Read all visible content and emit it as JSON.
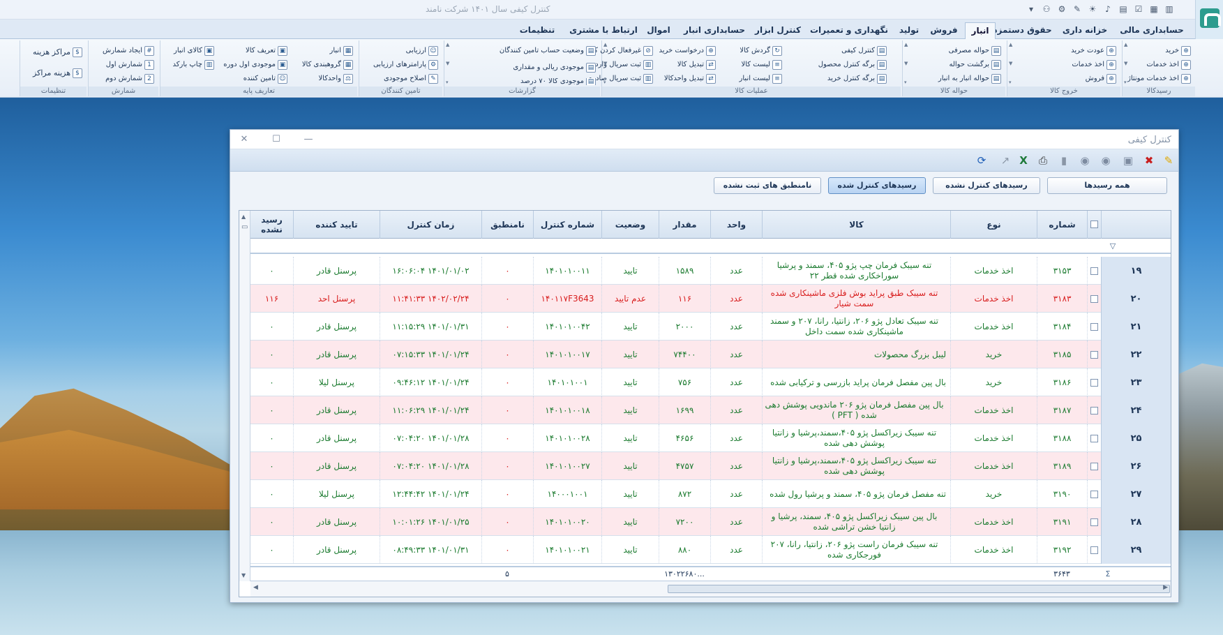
{
  "window_title": "کنترل کیفی    سال ۱۴۰۱ شرکت نامند",
  "ribbon_tabs": [
    "حسابداری مالی",
    "خزانه داری",
    "حقوق دستمزد",
    "انبار",
    "فروش",
    "تولید",
    "نگهداری و تعمیرات",
    "کنترل ابزار",
    "حسابداری انبار",
    "اموال",
    "ارتباط با مشتری",
    "تنظیمات"
  ],
  "active_tab": "انبار",
  "ribbon_groups": {
    "receipt": {
      "label": "رسیدکالا",
      "items": [
        "خرید",
        "اخذ خدمات",
        "اخذ خدمات مونتاژ"
      ]
    },
    "exit": {
      "label": "خروج کالا",
      "items": [
        "عودت خرید",
        "اخذ خدمات",
        "فروش"
      ]
    },
    "transfer": {
      "label": "حواله کالا",
      "items": [
        "حواله مصرفی",
        "برگشت حواله",
        "حواله انبار به انبار"
      ]
    },
    "ops": {
      "label": "عملیات کالا",
      "items": [
        "کنترل کیفی",
        "برگه کنترل محصول",
        "برگه کنترل خرید",
        "گردش کالا",
        "لیست کالا",
        "لیست انبار",
        "درخواست خرید",
        "تبدیل کالا",
        "تبدیل واحدکالا",
        "غیرفعال کردن کالا",
        "ثبت سریال وارده",
        "ثبت سریال صادره"
      ]
    },
    "reports": {
      "label": "گزارشات",
      "items": [
        "وضعیت حساب تامین کنندگان",
        "موجودی ریالی و مقداری",
        "موجودی کالا ۷۰ درصد"
      ]
    },
    "suppliers": {
      "label": "تامین کنندگان",
      "items": [
        "ارزیابی",
        "پارامترهای ارزیابی",
        "اصلاح موجودی"
      ]
    },
    "base": {
      "label": "تعاریف پایه",
      "items": [
        "انبار",
        "گروهبندی کالا",
        "واحدکالا",
        "تعریف کالا",
        "موجودی اول دوره",
        "تامین کننده",
        "کالای انبار",
        "چاپ بارکد"
      ]
    },
    "numbering": {
      "label": "شمارش",
      "items": [
        "ایجاد شمارش",
        "شمارش اول",
        "شمارش دوم"
      ]
    },
    "settings": {
      "label": "تنظیمات",
      "items": [
        "مراکز هزینه",
        "هزینه مراکز"
      ]
    }
  },
  "dialog": {
    "title": "کنترل کیفی",
    "filters": [
      "همه رسیدها",
      "رسیدهای کنترل نشده",
      "رسیدهای کنترل شده",
      "نامنطبق های ثبت نشده"
    ],
    "active_filter": "رسیدهای کنترل شده"
  },
  "grid": {
    "headers": {
      "number": "شماره",
      "type": "نوع",
      "product": "کالا",
      "unit": "واحد",
      "qty": "مقدار",
      "status": "وضعیت",
      "control_no": "شماره کنترل",
      "nonconform": "نامنطبق",
      "control_time": "زمان کنترل",
      "approver": "تایید کننده",
      "unreceived": "رسید نشده"
    },
    "rows": [
      {
        "idx": "۱۹",
        "number": "۳۱۵۳",
        "type": "اخذ خدمات",
        "product": "تنه سیبک فرمان چپ پژو ۴۰۵، سمند و پرشیا سوراخکاری شده قطر ۲۲",
        "unit": "عدد",
        "qty": "۱۵۸۹",
        "status": "تایید",
        "control_no": "۱۴۰۱۰۱۰۰۱۱",
        "nonconform": "۰",
        "control_time": "۱۴۰۱/۰۱/۰۲ ۱۶:۰۶:۰۴",
        "approver": "پرسنل قادر",
        "unreceived": "۰",
        "alt": false,
        "bad": false
      },
      {
        "idx": "۲۰",
        "number": "۳۱۸۳",
        "type": "اخذ خدمات",
        "product": "تنه سیبک طبق پراید بوش فلزی ماشینکاری شده سمت شیار",
        "unit": "عدد",
        "qty": "۱۱۶",
        "status": "عدم تایید",
        "control_no": "۱۴۰۱۱۷F3643",
        "nonconform": "۰",
        "control_time": "۱۴۰۲/۰۲/۲۴ ۱۱:۴۱:۳۳",
        "approver": "پرسنل احد",
        "unreceived": "۱۱۶",
        "alt": true,
        "bad": true
      },
      {
        "idx": "۲۱",
        "number": "۳۱۸۴",
        "type": "اخذ خدمات",
        "product": "تنه سیبک تعادل پژو ۲۰۶، زانتیا، رانا، ۲۰۷ و سمند ماشینکاری شده سمت داخل",
        "unit": "عدد",
        "qty": "۲۰۰۰",
        "status": "تایید",
        "control_no": "۱۴۰۱۰۱۰۰۴۲",
        "nonconform": "۰",
        "control_time": "۱۴۰۱/۰۱/۳۱ ۱۱:۱۵:۲۹",
        "approver": "پرسنل قادر",
        "unreceived": "۰",
        "alt": false,
        "bad": false
      },
      {
        "idx": "۲۲",
        "number": "۳۱۸۵",
        "type": "خرید",
        "product": "لیبل بزرگ محصولات",
        "unit": "عدد",
        "qty": "۷۴۴۰۰",
        "status": "تایید",
        "control_no": "۱۴۰۱۰۱۰۰۱۷",
        "nonconform": "۰",
        "control_time": "۱۴۰۱/۰۱/۲۴ ۰۷:۱۵:۳۳",
        "approver": "پرسنل قادر",
        "unreceived": "۰",
        "alt": true,
        "bad": false
      },
      {
        "idx": "۲۳",
        "number": "۳۱۸۶",
        "type": "خرید",
        "product": "بال پین مفصل فرمان پراید بازرسی و ترکیابی شده",
        "unit": "عدد",
        "qty": "۷۵۶",
        "status": "تایید",
        "control_no": "۱۴۰۱۰۱۰۰۱",
        "nonconform": "۰",
        "control_time": "۱۴۰۱/۰۱/۲۴ ۰۹:۴۶:۱۲",
        "approver": "پرسنل لیلا",
        "unreceived": "۰",
        "alt": false,
        "bad": false
      },
      {
        "idx": "۲۴",
        "number": "۳۱۸۷",
        "type": "اخذ خدمات",
        "product": "بال پین مفصل فرمان پژو ۲۰۶ ماندویی پوشش دهی شده  ( PFT )",
        "unit": "عدد",
        "qty": "۱۶۹۹",
        "status": "تایید",
        "control_no": "۱۴۰۱۰۱۰۰۱۸",
        "nonconform": "۰",
        "control_time": "۱۴۰۱/۰۱/۲۴ ۱۱:۰۶:۲۹",
        "approver": "پرسنل قادر",
        "unreceived": "۰",
        "alt": true,
        "bad": false
      },
      {
        "idx": "۲۵",
        "number": "۳۱۸۸",
        "type": "اخذ خدمات",
        "product": "تنه سیبک زیراکسل پژو ۴۰۵،سمند،پرشیا و زانتیا پوشش دهی شده",
        "unit": "عدد",
        "qty": "۴۶۵۶",
        "status": "تایید",
        "control_no": "۱۴۰۱۰۱۰۰۲۸",
        "nonconform": "۰",
        "control_time": "۱۴۰۱/۰۱/۲۸ ۰۷:۰۴:۲۰",
        "approver": "پرسنل قادر",
        "unreceived": "۰",
        "alt": false,
        "bad": false
      },
      {
        "idx": "۲۶",
        "number": "۳۱۸۹",
        "type": "اخذ خدمات",
        "product": "تنه سیبک زیراکسل پژو ۴۰۵،سمند،پرشیا و زانتیا پوشش دهی شده",
        "unit": "عدد",
        "qty": "۴۷۵۷",
        "status": "تایید",
        "control_no": "۱۴۰۱۰۱۰۰۲۷",
        "nonconform": "۰",
        "control_time": "۱۴۰۱/۰۱/۲۸ ۰۷:۰۴:۲۰",
        "approver": "پرسنل قادر",
        "unreceived": "۰",
        "alt": true,
        "bad": false
      },
      {
        "idx": "۲۷",
        "number": "۳۱۹۰",
        "type": "خرید",
        "product": "تنه مفصل فرمان پژو ۴۰۵، سمند و پرشیا رول شده",
        "unit": "عدد",
        "qty": "۸۷۲",
        "status": "تایید",
        "control_no": "۱۴۰۰۰۱۰۰۱",
        "nonconform": "۰",
        "control_time": "۱۴۰۱/۰۱/۲۴ ۱۲:۴۴:۴۲",
        "approver": "پرسنل لیلا",
        "unreceived": "۰",
        "alt": false,
        "bad": false
      },
      {
        "idx": "۲۸",
        "number": "۳۱۹۱",
        "type": "اخذ خدمات",
        "product": "بال پین سیبک زیراکسل پژو ۴۰۵، سمند، پرشیا و زانتیا خشن تراشی شده",
        "unit": "عدد",
        "qty": "۷۲۰۰",
        "status": "تایید",
        "control_no": "۱۴۰۱۰۱۰۰۲۰",
        "nonconform": "۰",
        "control_time": "۱۴۰۱/۰۱/۲۵ ۱۰:۰۱:۲۶",
        "approver": "پرسنل قادر",
        "unreceived": "۰",
        "alt": true,
        "bad": false
      },
      {
        "idx": "۲۹",
        "number": "۳۱۹۲",
        "type": "اخذ خدمات",
        "product": "تنه سیبک فرمان راست پژو ۲۰۶، زانتیا، رانا، ۲۰۷ فورجکاری شده",
        "unit": "عدد",
        "qty": "۸۸۰",
        "status": "تایید",
        "control_no": "۱۴۰۱۰۱۰۰۲۱",
        "nonconform": "۰",
        "control_time": "۱۴۰۱/۰۱/۳۱ ۰۸:۴۹:۳۳",
        "approver": "پرسنل قادر",
        "unreceived": "۰",
        "alt": false,
        "bad": false
      }
    ],
    "footer": {
      "number_total": "۳۶۴۳",
      "qty_total": "...۱۳۰۲۲۶۸۰",
      "nonconform_total": "۵"
    }
  }
}
